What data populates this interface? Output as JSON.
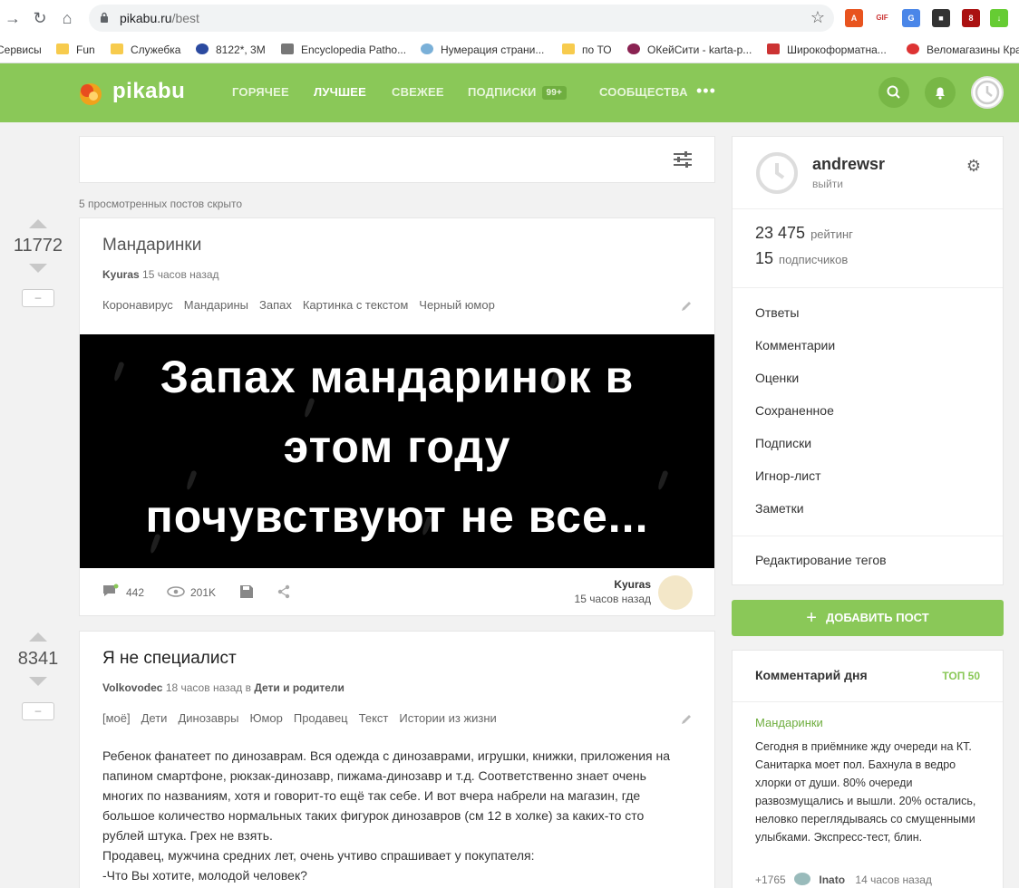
{
  "browser": {
    "url_host": "pikabu.ru",
    "url_path": "/best",
    "bookmarks": [
      {
        "label": "Сервисы",
        "icon": "apps-icon"
      },
      {
        "label": "Fun",
        "icon": "folder-icon"
      },
      {
        "label": "Служебка",
        "icon": "folder-icon"
      },
      {
        "label": "8122*, 3M",
        "icon": "site-icon"
      },
      {
        "label": "Encyclopedia Patho...",
        "icon": "site-icon"
      },
      {
        "label": "Нумерация страни...",
        "icon": "site-icon"
      },
      {
        "label": "по ТО",
        "icon": "folder-icon"
      },
      {
        "label": "ОКейСити - karta-p...",
        "icon": "site-icon"
      },
      {
        "label": "Широкоформатна...",
        "icon": "site-icon"
      },
      {
        "label": "Веломагазины Кра",
        "icon": "pin-icon"
      }
    ],
    "ext_badge": "8"
  },
  "header": {
    "logo": "pikabu",
    "menu": [
      "ГОРЯЧЕЕ",
      "ЛУЧШЕЕ",
      "СВЕЖЕЕ",
      "ПОДПИСКИ",
      "СООБЩЕСТВА"
    ],
    "subs_badge": "99+",
    "more": "•••"
  },
  "feed": {
    "hidden_note": "5 просмотренных постов скрыто",
    "minus_label": "–",
    "posts": [
      {
        "rating": "11772",
        "title": "Мандаринки",
        "author": "Kyuras",
        "time": "15 часов назад",
        "tags": [
          "Коронавирус",
          "Мандарины",
          "Запах",
          "Картинка с текстом",
          "Черный юмор"
        ],
        "image_lines": [
          "Запах мандаринок в",
          "этом году",
          "почувствуют не все..."
        ],
        "comments": "442",
        "views": "201K",
        "footer_author": "Kyuras",
        "footer_time": "15 часов назад"
      },
      {
        "rating": "8341",
        "title": "Я не специалист",
        "author": "Volkovodec",
        "time": "18 часов назад в",
        "community": "Дети и родители",
        "tags": [
          "[моё]",
          "Дети",
          "Динозавры",
          "Юмор",
          "Продавец",
          "Текст",
          "Истории из жизни"
        ],
        "body": [
          "Ребенок фанатеет по динозаврам. Вся одежда с динозаврами, игрушки, книжки, приложения на",
          "папином смартфоне, рюкзак-динозавр, пижама-динозавр и т.д. Соответственно знает очень",
          "многих по названиям, хотя и говорит-то ещё так себе. И вот вчера набрели на магазин, где",
          "большое количество нормальных таких фигурок динозавров (см 12 в холке) за каких-то сто",
          "рублей штука. Грех не взять.",
          "Продавец, мужчина средних лет, очень учтиво спрашивает у покупателя:",
          "-Что Вы хотите, молодой человек?"
        ]
      }
    ]
  },
  "sidebar": {
    "username": "andrewsr",
    "logout": "выйти",
    "rating_value": "23 475",
    "rating_label": "рейтинг",
    "subs_value": "15",
    "subs_label": "подписчиков",
    "links": [
      "Ответы",
      "Комментарии",
      "Оценки",
      "Сохраненное",
      "Подписки",
      "Игнор-лист",
      "Заметки"
    ],
    "edit_tags": "Редактирование тегов",
    "add_post": "ДОБАВИТЬ ПОСТ",
    "cotd": {
      "title": "Комментарий дня",
      "top": "ТОП 50",
      "post": "Мандаринки",
      "text": "Сегодня в приёмнике жду очереди на КТ. Санитарка моет пол. Бахнула в ведро хлорки от души. 80% очереди развозмущались и вышли. 20% остались, неловко переглядываясь со смущенными улыбками. Экспресс-тест, блин.",
      "score": "+1765",
      "author": "Inato",
      "time": "14 часов назад"
    }
  },
  "colors": {
    "brand_green": "#8ac858",
    "link_green": "#6fae3f"
  }
}
